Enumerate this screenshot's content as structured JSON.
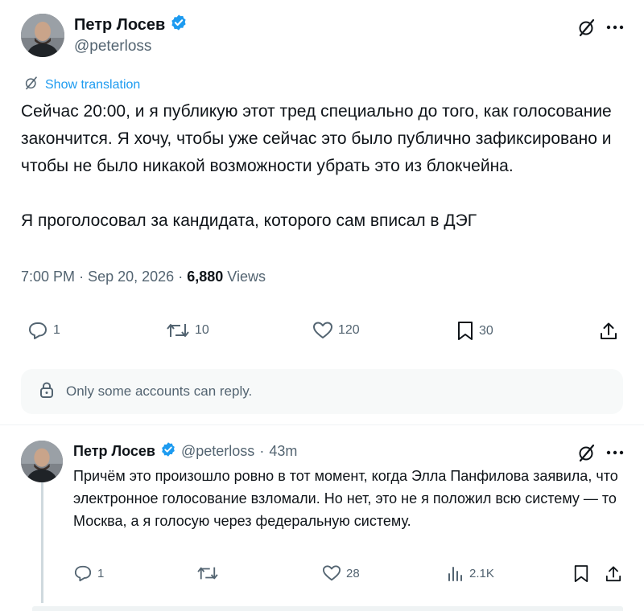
{
  "colors": {
    "accent": "#1d9bf0",
    "text": "#0f1419",
    "muted": "#536471",
    "divider": "#eff3f4"
  },
  "main_tweet": {
    "author_name": "Петр Лосев",
    "handle": "@peterloss",
    "show_translation": "Show translation",
    "text_paragraphs": [
      "Сейчас 20:00, и я публикую этот тред специально до того, как голосование закончится. Я хочу, чтобы уже сейчас это было публично зафиксировано и чтобы не было никакой возможности убрать это из блокчейна.",
      "Я проголосовал за кандидата, которого сам вписал в ДЭГ"
    ],
    "time": "7:00 PM",
    "date": "Sep 20, 2026",
    "separator": "·",
    "views_count": "6,880",
    "views_label": "Views",
    "actions": {
      "replies": "1",
      "reposts": "10",
      "likes": "120",
      "bookmarks": "30"
    },
    "icons": [
      "grok-icon",
      "more-icon",
      "reply-icon",
      "repost-icon",
      "like-icon",
      "bookmark-icon",
      "share-icon"
    ]
  },
  "reply_restriction": "Only some accounts can reply.",
  "reply_tweet": {
    "author_name": "Петр Лосев",
    "handle": "@peterloss",
    "separator": "·",
    "time_ago": "43m",
    "text": "Причём это произошло ровно в тот момент, когда Элла Панфилова заявила, что электронное голосование взломали. Но нет, это не я положил всю систему — то Москва, а я голосую через федеральную систему.",
    "actions": {
      "replies": "1",
      "reposts": "",
      "likes": "28",
      "views": "2.1K"
    }
  }
}
